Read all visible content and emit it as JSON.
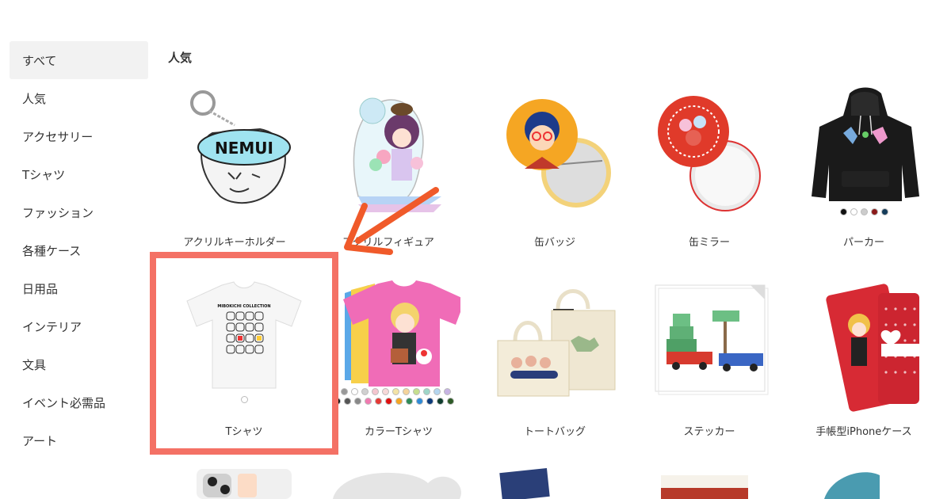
{
  "sidebar": {
    "items": [
      {
        "label": "すべて",
        "active": true
      },
      {
        "label": "人気",
        "active": false
      },
      {
        "label": "アクセサリー",
        "active": false
      },
      {
        "label": "Tシャツ",
        "active": false
      },
      {
        "label": "ファッション",
        "active": false
      },
      {
        "label": "各種ケース",
        "active": false
      },
      {
        "label": "日用品",
        "active": false
      },
      {
        "label": "インテリア",
        "active": false
      },
      {
        "label": "文具",
        "active": false
      },
      {
        "label": "イベント必需品",
        "active": false
      },
      {
        "label": "アート",
        "active": false
      }
    ]
  },
  "main": {
    "section_title": "人気",
    "products": [
      {
        "name": "アクリルキーホルダー"
      },
      {
        "name": "アクリルフィギュア"
      },
      {
        "name": "缶バッジ"
      },
      {
        "name": "缶ミラー"
      },
      {
        "name": "パーカー"
      },
      {
        "name": "Tシャツ"
      },
      {
        "name": "カラーTシャツ"
      },
      {
        "name": "トートバッグ"
      },
      {
        "name": "ステッカー"
      },
      {
        "name": "手帳型iPhoneケース"
      }
    ],
    "keychain_text": "NEMUI",
    "tshirt_print_text": "MIBOKICHI COLLECTION",
    "hoodie_colors": [
      "#111111",
      "#ffffff",
      "#cccccc",
      "#8b1a1a",
      "#143c5a"
    ],
    "tshirt_colors": [
      "#ffffff"
    ],
    "color_tshirt_colors_row1": [
      "#999999",
      "#ffffff",
      "#d0d0d0",
      "#f4c6cf",
      "#f7d9d9",
      "#f3e3a6",
      "#f5d49b",
      "#c6df8e",
      "#9ed6c8",
      "#b5d6ef",
      "#c7b3e3"
    ],
    "color_tshirt_colors_row2": [
      "#111111",
      "#555555",
      "#888888",
      "#f07ab0",
      "#e53935",
      "#e01010",
      "#f5a623",
      "#2e8b57",
      "#2e8bd8",
      "#0b3a7a",
      "#0f3d2e",
      "#2d5a27"
    ]
  },
  "colors": {
    "highlight": "#f47165",
    "sidebar_active_bg": "#f2f2f2"
  }
}
